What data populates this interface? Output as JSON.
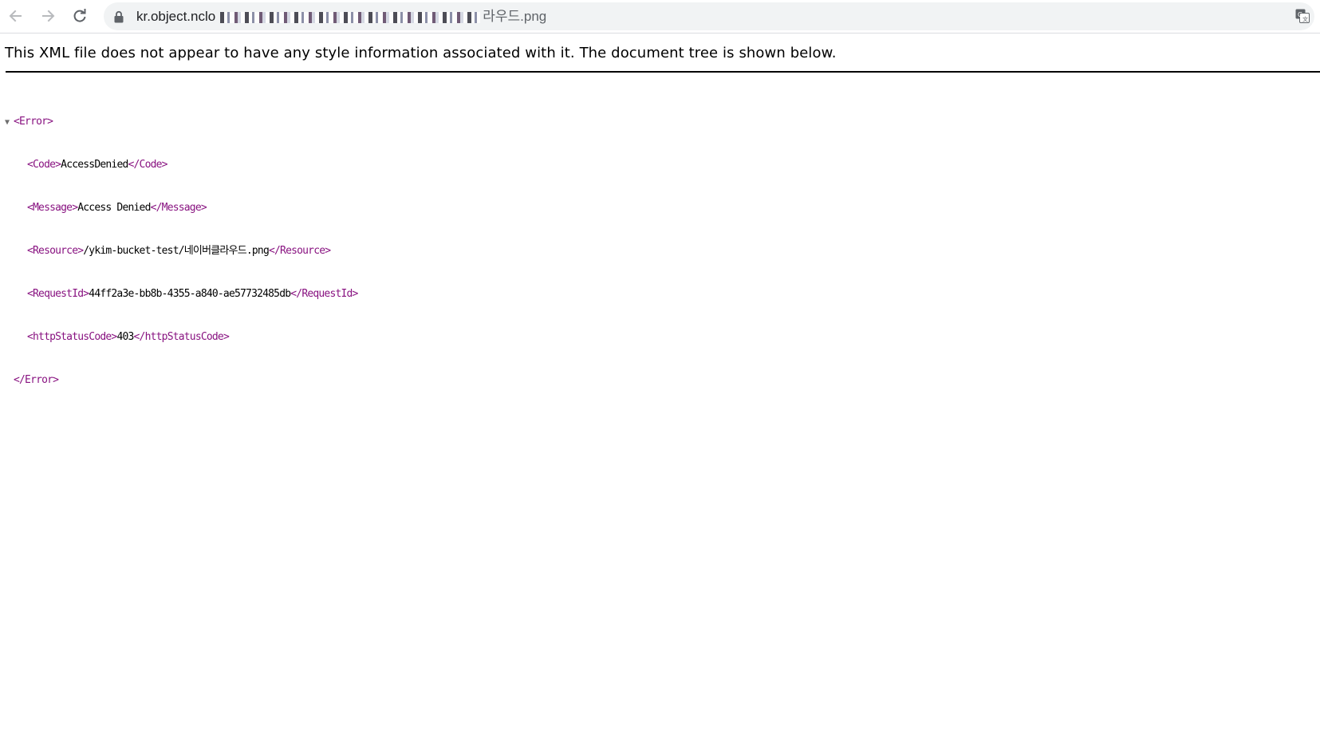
{
  "browser": {
    "url_prefix": "kr.object.nclo",
    "url_suffix": "라우드.png",
    "icons": {
      "back": "arrow-left-icon",
      "forward": "arrow-right-icon",
      "reload": "reload-icon",
      "lock": "lock-icon",
      "translate": "translate-icon"
    }
  },
  "banner": {
    "text": "This XML file does not appear to have any style information associated with it. The document tree is shown below."
  },
  "xml": {
    "collapse_glyph": "▼",
    "root_open": "<Error>",
    "root_close": "</Error>",
    "children": [
      {
        "open": "<Code>",
        "value": "AccessDenied",
        "close": "</Code>"
      },
      {
        "open": "<Message>",
        "value": "Access Denied",
        "close": "</Message>"
      },
      {
        "open": "<Resource>",
        "value": "/ykim-bucket-test/네이버클라우드.png",
        "close": "</Resource>"
      },
      {
        "open": "<RequestId>",
        "value": "44ff2a3e-bb8b-4355-a840-ae57732485db",
        "close": "</RequestId>"
      },
      {
        "open": "<httpStatusCode>",
        "value": "403",
        "close": "</httpStatusCode>"
      }
    ]
  },
  "colors": {
    "tag": "#881280",
    "text": "#000000",
    "omnibox": "#f1f3f4"
  }
}
